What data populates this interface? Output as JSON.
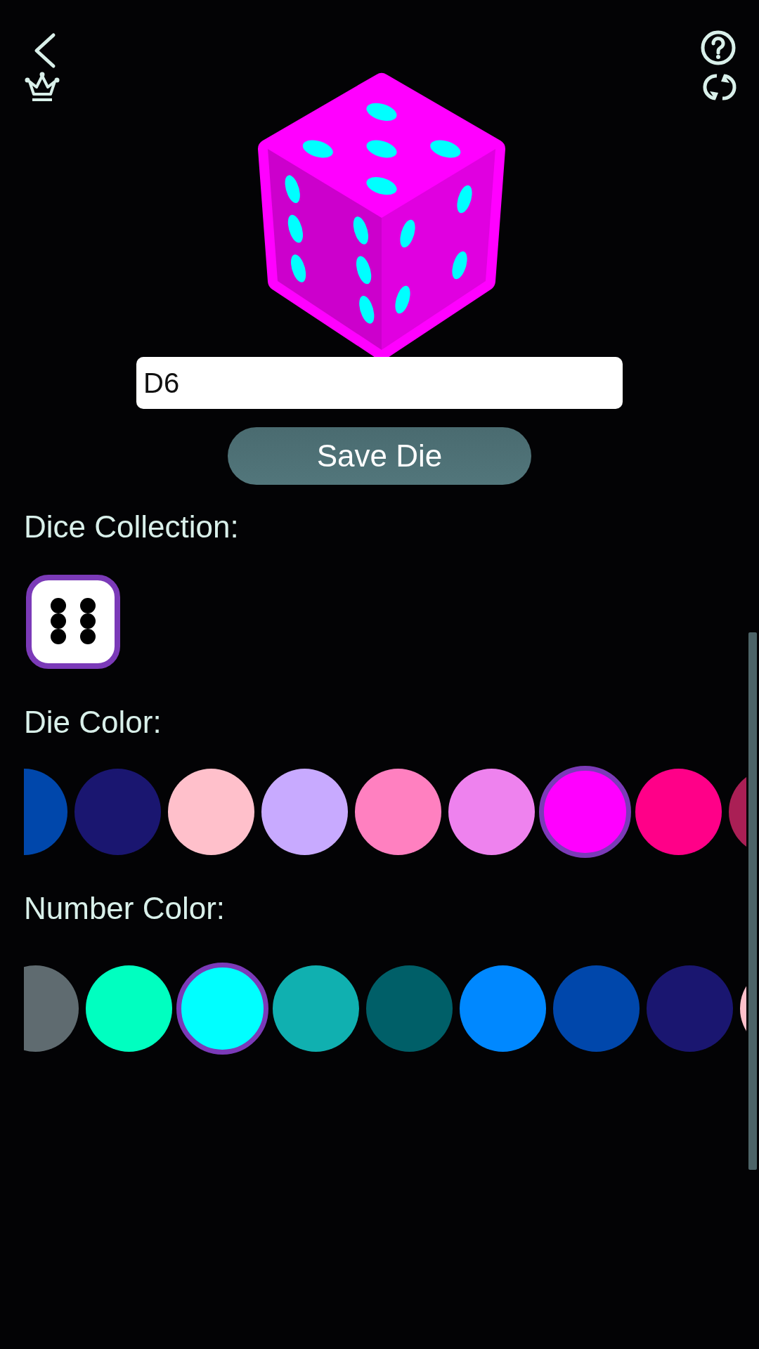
{
  "name_field": {
    "value": "D6"
  },
  "save_button": {
    "label": "Save Die"
  },
  "dice_collection": {
    "label": "Dice Collection:",
    "items": [
      {
        "selected": true
      }
    ]
  },
  "die_color": {
    "label": "Die Color:",
    "swatches": [
      {
        "color": "#0047ab",
        "selected": false
      },
      {
        "color": "#1a1670",
        "selected": false
      },
      {
        "color": "#ffc0cb",
        "selected": false
      },
      {
        "color": "#c8aaff",
        "selected": false
      },
      {
        "color": "#ff80c0",
        "selected": false
      },
      {
        "color": "#ee82ee",
        "selected": false
      },
      {
        "color": "#ff00ff",
        "selected": true
      },
      {
        "color": "#ff0088",
        "selected": false
      },
      {
        "color": "#aa1f55",
        "selected": false
      }
    ]
  },
  "number_color": {
    "label": "Number Color:",
    "swatches": [
      {
        "color": "#5f6b70",
        "selected": false
      },
      {
        "color": "#00ffc0",
        "selected": false
      },
      {
        "color": "#00ffff",
        "selected": true
      },
      {
        "color": "#10b0b0",
        "selected": false
      },
      {
        "color": "#005f68",
        "selected": false
      },
      {
        "color": "#0088ff",
        "selected": false
      },
      {
        "color": "#0047ab",
        "selected": false
      },
      {
        "color": "#1a1670",
        "selected": false
      },
      {
        "color": "#ffc0cb",
        "selected": false
      }
    ]
  }
}
